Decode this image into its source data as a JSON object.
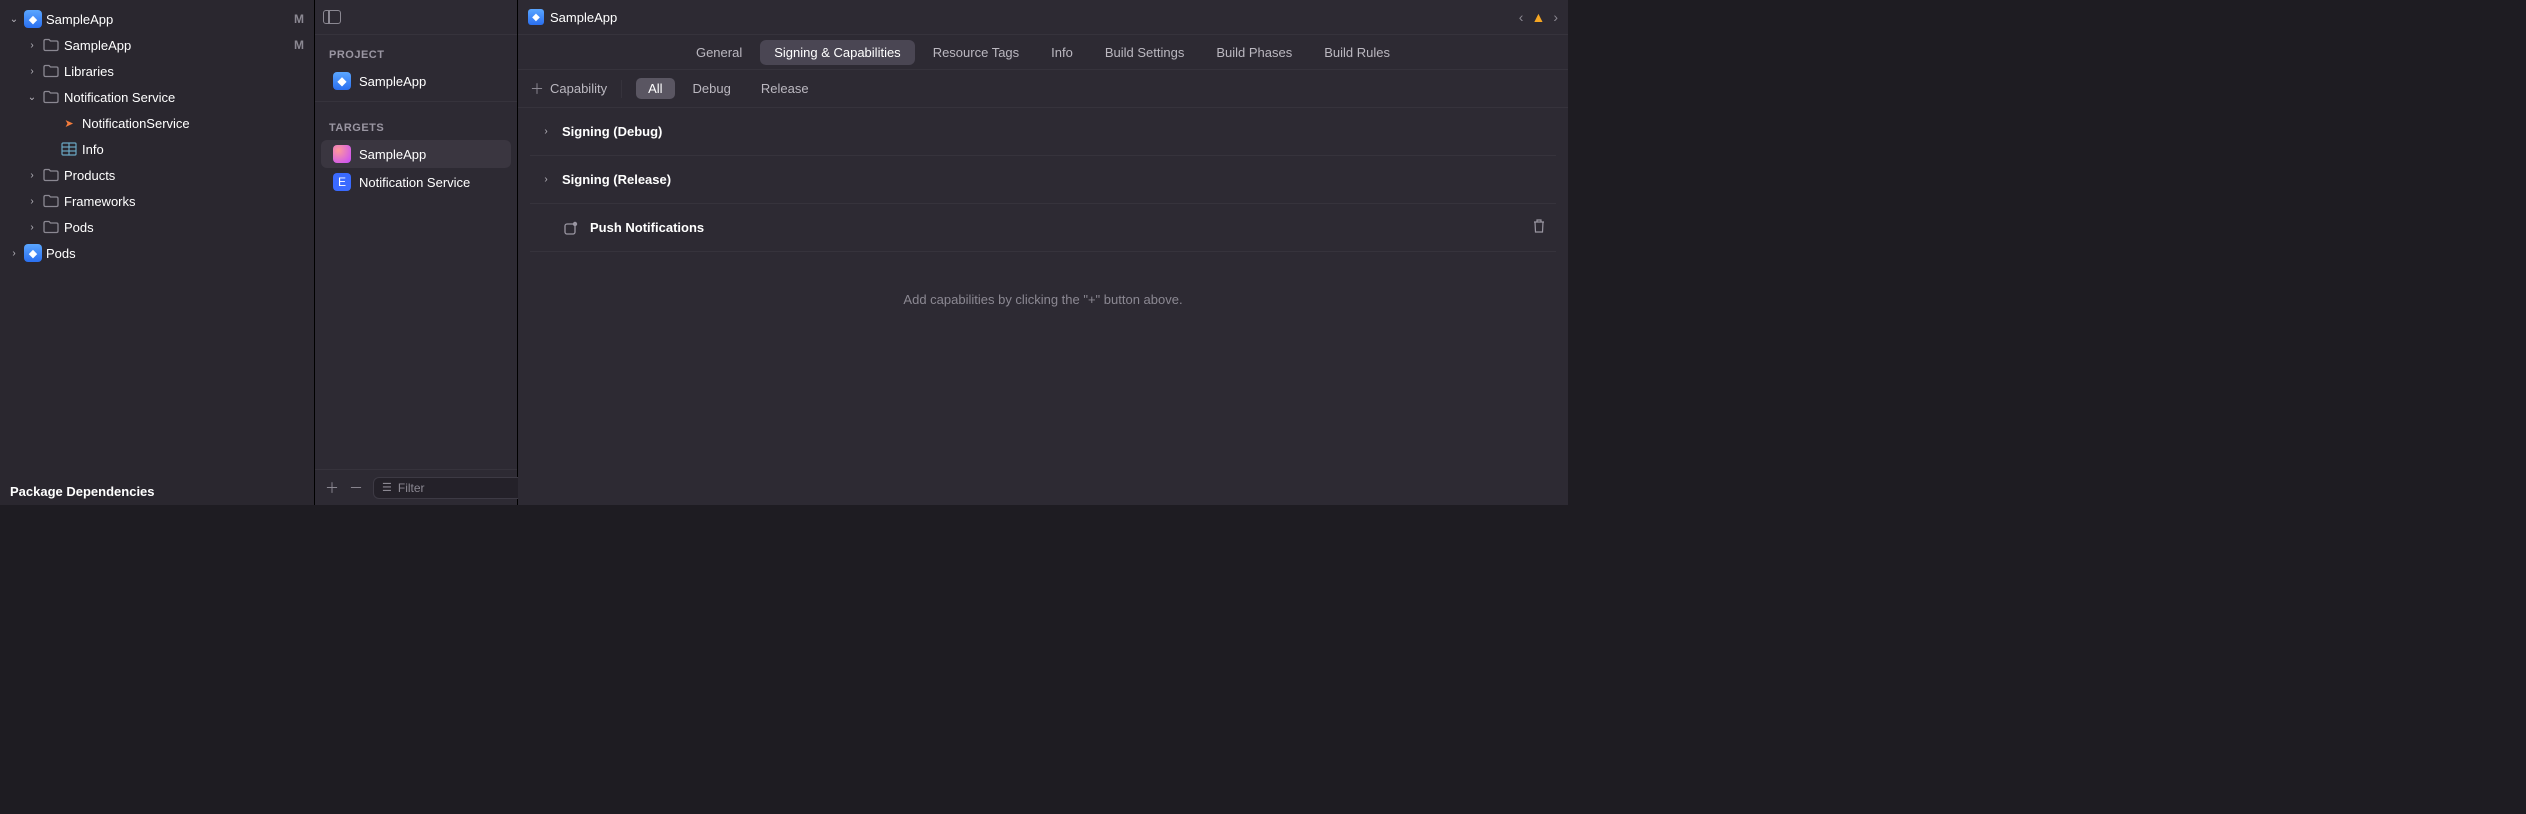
{
  "navigator": {
    "tree": [
      {
        "depth": 0,
        "disclosure": "down",
        "icon": "appblue",
        "label": "SampleApp",
        "badge": "M"
      },
      {
        "depth": 1,
        "disclosure": "right",
        "icon": "folder",
        "label": "SampleApp",
        "badge": "M"
      },
      {
        "depth": 1,
        "disclosure": "right",
        "icon": "folder",
        "label": "Libraries",
        "badge": ""
      },
      {
        "depth": 1,
        "disclosure": "down",
        "icon": "folder",
        "label": "Notification Service",
        "badge": ""
      },
      {
        "depth": 2,
        "disclosure": "",
        "icon": "swift",
        "label": "NotificationService",
        "badge": ""
      },
      {
        "depth": 2,
        "disclosure": "",
        "icon": "plist",
        "label": "Info",
        "badge": ""
      },
      {
        "depth": 1,
        "disclosure": "right",
        "icon": "folder",
        "label": "Products",
        "badge": ""
      },
      {
        "depth": 1,
        "disclosure": "right",
        "icon": "folder",
        "label": "Frameworks",
        "badge": ""
      },
      {
        "depth": 1,
        "disclosure": "right",
        "icon": "folder",
        "label": "Pods",
        "badge": ""
      },
      {
        "depth": 0,
        "disclosure": "right",
        "icon": "appblue",
        "label": "Pods",
        "badge": ""
      }
    ],
    "section_label": "Package Dependencies"
  },
  "outline": {
    "project_label": "PROJECT",
    "project_item": "SampleApp",
    "targets_label": "TARGETS",
    "targets": [
      {
        "icon": "appcirc",
        "label": "SampleApp",
        "selected": true
      },
      {
        "icon": "bell",
        "label": "Notification Service",
        "selected": false
      }
    ],
    "filter_placeholder": "Filter"
  },
  "editor": {
    "crumb_project": "SampleApp",
    "tabs": [
      {
        "label": "General",
        "selected": false
      },
      {
        "label": "Signing & Capabilities",
        "selected": true
      },
      {
        "label": "Resource Tags",
        "selected": false
      },
      {
        "label": "Info",
        "selected": false
      },
      {
        "label": "Build Settings",
        "selected": false
      },
      {
        "label": "Build Phases",
        "selected": false
      },
      {
        "label": "Build Rules",
        "selected": false
      }
    ],
    "add_capability_label": "Capability",
    "config_pills": [
      {
        "label": "All",
        "selected": true
      },
      {
        "label": "Debug",
        "selected": false
      },
      {
        "label": "Release",
        "selected": false
      }
    ],
    "capabilities": [
      {
        "disclosure": true,
        "icon": "",
        "label": "Signing (Debug)",
        "deletable": false
      },
      {
        "disclosure": true,
        "icon": "",
        "label": "Signing (Release)",
        "deletable": false
      },
      {
        "disclosure": false,
        "icon": "push",
        "label": "Push Notifications",
        "deletable": true
      }
    ],
    "empty_hint": "Add capabilities by clicking the \"+\" button above."
  }
}
